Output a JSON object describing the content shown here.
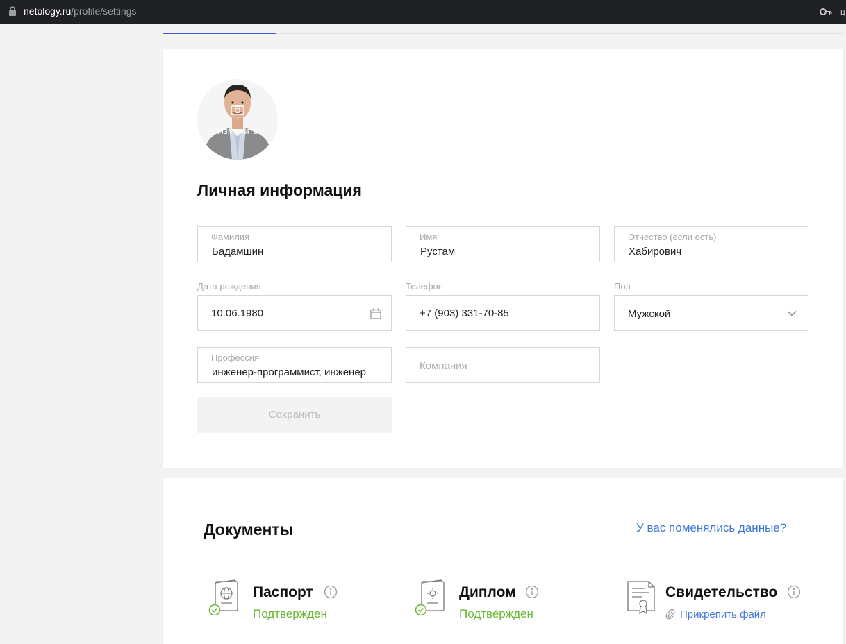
{
  "browser": {
    "url_domain": "netology.ru",
    "url_path": "/profile/settings"
  },
  "avatar": {
    "change_label": "Изменить"
  },
  "personal": {
    "title": "Личная информация",
    "last_name": {
      "label": "Фамилия",
      "value": "Бадамшин"
    },
    "first_name": {
      "label": "Имя",
      "value": "Рустам"
    },
    "patronymic": {
      "label": "Отчество (если есть)",
      "value": "Хабирович"
    },
    "birth_date": {
      "label": "Дата рождения",
      "value": "10.06.1980"
    },
    "phone": {
      "label": "Телефон",
      "value": "+7 (903) 331-70-85"
    },
    "gender": {
      "label": "Пол",
      "value": "Мужской"
    },
    "profession": {
      "label": "Профессия",
      "value": "инженер-программист, инженер"
    },
    "company": {
      "placeholder": "Компания",
      "value": ""
    },
    "save_label": "Сохранить"
  },
  "documents": {
    "title": "Документы",
    "changed_link": "У вас поменялись данные?",
    "items": [
      {
        "name": "Паспорт",
        "status": "Подтвержден",
        "icon": "passport-icon",
        "verified": true
      },
      {
        "name": "Диплом",
        "status": "Подтвержден",
        "icon": "diploma-icon",
        "verified": true
      },
      {
        "name": "Свидетельство",
        "status": "Прикрепить файл",
        "icon": "certificate-icon",
        "verified": false
      }
    ]
  },
  "colors": {
    "accent_blue": "#3f77d6",
    "status_green": "#69b733",
    "tab_indicator": "#3f5ad6"
  }
}
